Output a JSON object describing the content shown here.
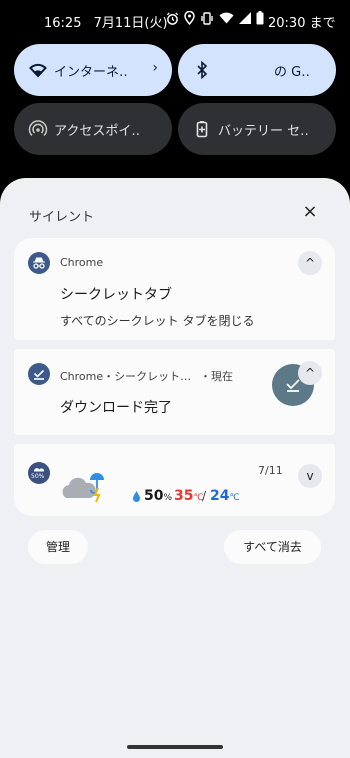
{
  "status_bar": {
    "time": "16:25",
    "date": "7月11日(火)",
    "icons": [
      "alarm-icon",
      "location-icon",
      "vibrate-icon",
      "wifi-icon",
      "signal-icon",
      "battery-icon"
    ],
    "battery_until": "20:30 まで"
  },
  "quick_settings": {
    "tiles": [
      {
        "icon": "wifi-icon",
        "label": "インターネ‥",
        "state": "on",
        "chevron": "›"
      },
      {
        "icon": "bluetooth-icon",
        "label": "の G‥",
        "state": "on"
      },
      {
        "icon": "hotspot-icon",
        "label": "アクセスポイ‥",
        "state": "off"
      },
      {
        "icon": "battery-saver-icon",
        "label": "バッテリー セ‥",
        "state": "off"
      }
    ]
  },
  "notifications": {
    "section_title": "サイレント",
    "close_glyph": "×",
    "items": [
      {
        "app": "Chrome",
        "icon": "incognito-icon",
        "title": "シークレットタブ",
        "body": "すべてのシークレット タブを閉じる",
        "expand_glyph": "^"
      },
      {
        "app": "Chrome・シークレット…",
        "time": "・現在",
        "icon": "download-done-icon",
        "title": "ダウンロード完了",
        "expand_glyph": "^"
      },
      {
        "icon": "weather-icon",
        "icon_text": "50%",
        "date": "7/11",
        "rain": "50",
        "rain_unit": "%",
        "high": "35",
        "high_unit": "℃",
        "separator": "/",
        "low": "24",
        "low_unit": "℃",
        "expand_glyph": "v"
      }
    ],
    "manage_label": "管理",
    "clear_all_label": "すべて消去"
  },
  "colors": {
    "tile_on": "#d3e3fd",
    "tile_off": "#2f3034",
    "shade_bg": "#eff0f3",
    "high_temp": "#e53935",
    "low_temp": "#1e6ad8",
    "rain_drop": "#2f8de4"
  }
}
